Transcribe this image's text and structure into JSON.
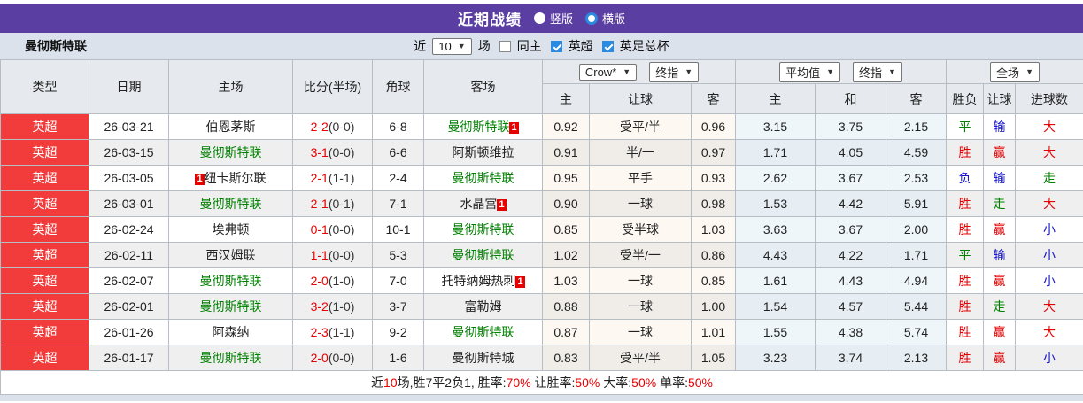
{
  "colors": {
    "accent_purple": "#5b3ea1",
    "type_red": "#f23c3c",
    "team_green": "#008000",
    "result_red": "#e60000",
    "result_blue": "#1515cc",
    "result_green": "#008000"
  },
  "title_bar": {
    "title": "近期战绩",
    "radio_vertical": "竖版",
    "radio_horizontal": "横版"
  },
  "filter_bar": {
    "team_name": "曼彻斯特联",
    "recent_label": "近",
    "recent_value": "10",
    "matches_label": "场",
    "same_home_label": "同主",
    "league_label": "英超",
    "facup_label": "英足总杯"
  },
  "table": {
    "selects": {
      "source": "Crow*",
      "final1": "终指",
      "average": "平均值",
      "final2": "终指",
      "scope": "全场"
    },
    "headers": [
      "类型",
      "日期",
      "主场",
      "比分(半场)",
      "角球",
      "客场"
    ],
    "sub_headers": [
      "主",
      "让球",
      "客",
      "主",
      "和",
      "客",
      "胜负",
      "让球",
      "进球数"
    ],
    "rows": [
      {
        "type": "英超",
        "date": "26-03-21",
        "home": "伯恩茅斯",
        "home_green": false,
        "home_badge": "",
        "score_ft": "2-2",
        "score_ht": "(0-0)",
        "corners": "6-8",
        "away": "曼彻斯特联",
        "away_green": true,
        "away_badge": "1",
        "asian_home": "0.92",
        "handicap": "受平/半",
        "asian_away": "0.96",
        "euro_home": "3.15",
        "euro_draw": "3.75",
        "euro_away": "2.15",
        "result": "平",
        "result_color": "green",
        "handicap_result": "输",
        "handicap_result_color": "blue",
        "goals": "大",
        "goals_color": "red"
      },
      {
        "type": "英超",
        "date": "26-03-15",
        "home": "曼彻斯特联",
        "home_green": true,
        "home_badge": "",
        "score_ft": "3-1",
        "score_ht": "(0-0)",
        "corners": "6-6",
        "away": "阿斯顿维拉",
        "away_green": false,
        "away_badge": "",
        "asian_home": "0.91",
        "handicap": "半/一",
        "asian_away": "0.97",
        "euro_home": "1.71",
        "euro_draw": "4.05",
        "euro_away": "4.59",
        "result": "胜",
        "result_color": "red",
        "handicap_result": "赢",
        "handicap_result_color": "red",
        "goals": "大",
        "goals_color": "red"
      },
      {
        "type": "英超",
        "date": "26-03-05",
        "home": "纽卡斯尔联",
        "home_green": false,
        "home_badge": "1",
        "score_ft": "2-1",
        "score_ht": "(1-1)",
        "corners": "2-4",
        "away": "曼彻斯特联",
        "away_green": true,
        "away_badge": "",
        "asian_home": "0.95",
        "handicap": "平手",
        "asian_away": "0.93",
        "euro_home": "2.62",
        "euro_draw": "3.67",
        "euro_away": "2.53",
        "result": "负",
        "result_color": "blue",
        "handicap_result": "输",
        "handicap_result_color": "blue",
        "goals": "走",
        "goals_color": "green"
      },
      {
        "type": "英超",
        "date": "26-03-01",
        "home": "曼彻斯特联",
        "home_green": true,
        "home_badge": "",
        "score_ft": "2-1",
        "score_ht": "(0-1)",
        "corners": "7-1",
        "away": "水晶宫",
        "away_green": false,
        "away_badge": "1",
        "asian_home": "0.90",
        "handicap": "一球",
        "asian_away": "0.98",
        "euro_home": "1.53",
        "euro_draw": "4.42",
        "euro_away": "5.91",
        "result": "胜",
        "result_color": "red",
        "handicap_result": "走",
        "handicap_result_color": "green",
        "goals": "大",
        "goals_color": "red"
      },
      {
        "type": "英超",
        "date": "26-02-24",
        "home": "埃弗顿",
        "home_green": false,
        "home_badge": "",
        "score_ft": "0-1",
        "score_ht": "(0-0)",
        "corners": "10-1",
        "away": "曼彻斯特联",
        "away_green": true,
        "away_badge": "",
        "asian_home": "0.85",
        "handicap": "受半球",
        "asian_away": "1.03",
        "euro_home": "3.63",
        "euro_draw": "3.67",
        "euro_away": "2.00",
        "result": "胜",
        "result_color": "red",
        "handicap_result": "赢",
        "handicap_result_color": "red",
        "goals": "小",
        "goals_color": "blue"
      },
      {
        "type": "英超",
        "date": "26-02-11",
        "home": "西汉姆联",
        "home_green": false,
        "home_badge": "",
        "score_ft": "1-1",
        "score_ht": "(0-0)",
        "corners": "5-3",
        "away": "曼彻斯特联",
        "away_green": true,
        "away_badge": "",
        "asian_home": "1.02",
        "handicap": "受半/一",
        "asian_away": "0.86",
        "euro_home": "4.43",
        "euro_draw": "4.22",
        "euro_away": "1.71",
        "result": "平",
        "result_color": "green",
        "handicap_result": "输",
        "handicap_result_color": "blue",
        "goals": "小",
        "goals_color": "blue"
      },
      {
        "type": "英超",
        "date": "26-02-07",
        "home": "曼彻斯特联",
        "home_green": true,
        "home_badge": "",
        "score_ft": "2-0",
        "score_ht": "(1-0)",
        "corners": "7-0",
        "away": "托特纳姆热刺",
        "away_green": false,
        "away_badge": "1",
        "asian_home": "1.03",
        "handicap": "一球",
        "asian_away": "0.85",
        "euro_home": "1.61",
        "euro_draw": "4.43",
        "euro_away": "4.94",
        "result": "胜",
        "result_color": "red",
        "handicap_result": "赢",
        "handicap_result_color": "red",
        "goals": "小",
        "goals_color": "blue"
      },
      {
        "type": "英超",
        "date": "26-02-01",
        "home": "曼彻斯特联",
        "home_green": true,
        "home_badge": "",
        "score_ft": "3-2",
        "score_ht": "(1-0)",
        "corners": "3-7",
        "away": "富勒姆",
        "away_green": false,
        "away_badge": "",
        "asian_home": "0.88",
        "handicap": "一球",
        "asian_away": "1.00",
        "euro_home": "1.54",
        "euro_draw": "4.57",
        "euro_away": "5.44",
        "result": "胜",
        "result_color": "red",
        "handicap_result": "走",
        "handicap_result_color": "green",
        "goals": "大",
        "goals_color": "red"
      },
      {
        "type": "英超",
        "date": "26-01-26",
        "home": "阿森纳",
        "home_green": false,
        "home_badge": "",
        "score_ft": "2-3",
        "score_ht": "(1-1)",
        "corners": "9-2",
        "away": "曼彻斯特联",
        "away_green": true,
        "away_badge": "",
        "asian_home": "0.87",
        "handicap": "一球",
        "asian_away": "1.01",
        "euro_home": "1.55",
        "euro_draw": "4.38",
        "euro_away": "5.74",
        "result": "胜",
        "result_color": "red",
        "handicap_result": "赢",
        "handicap_result_color": "red",
        "goals": "大",
        "goals_color": "red"
      },
      {
        "type": "英超",
        "date": "26-01-17",
        "home": "曼彻斯特联",
        "home_green": true,
        "home_badge": "",
        "score_ft": "2-0",
        "score_ht": "(0-0)",
        "corners": "1-6",
        "away": "曼彻斯特城",
        "away_green": false,
        "away_badge": "",
        "asian_home": "0.83",
        "handicap": "受平/半",
        "asian_away": "1.05",
        "euro_home": "3.23",
        "euro_draw": "3.74",
        "euro_away": "2.13",
        "result": "胜",
        "result_color": "red",
        "handicap_result": "赢",
        "handicap_result_color": "red",
        "goals": "小",
        "goals_color": "blue"
      }
    ]
  },
  "footer": {
    "segments": [
      {
        "text": "近",
        "red": false
      },
      {
        "text": "10",
        "red": true
      },
      {
        "text": "场,胜7平2负1, 胜率:",
        "red": false
      },
      {
        "text": "70%",
        "red": true
      },
      {
        "text": " 让胜率:",
        "red": false
      },
      {
        "text": "50%",
        "red": true
      },
      {
        "text": " 大率:",
        "red": false
      },
      {
        "text": "50%",
        "red": true
      },
      {
        "text": " 单率:",
        "red": false
      },
      {
        "text": "50%",
        "red": true
      }
    ]
  }
}
